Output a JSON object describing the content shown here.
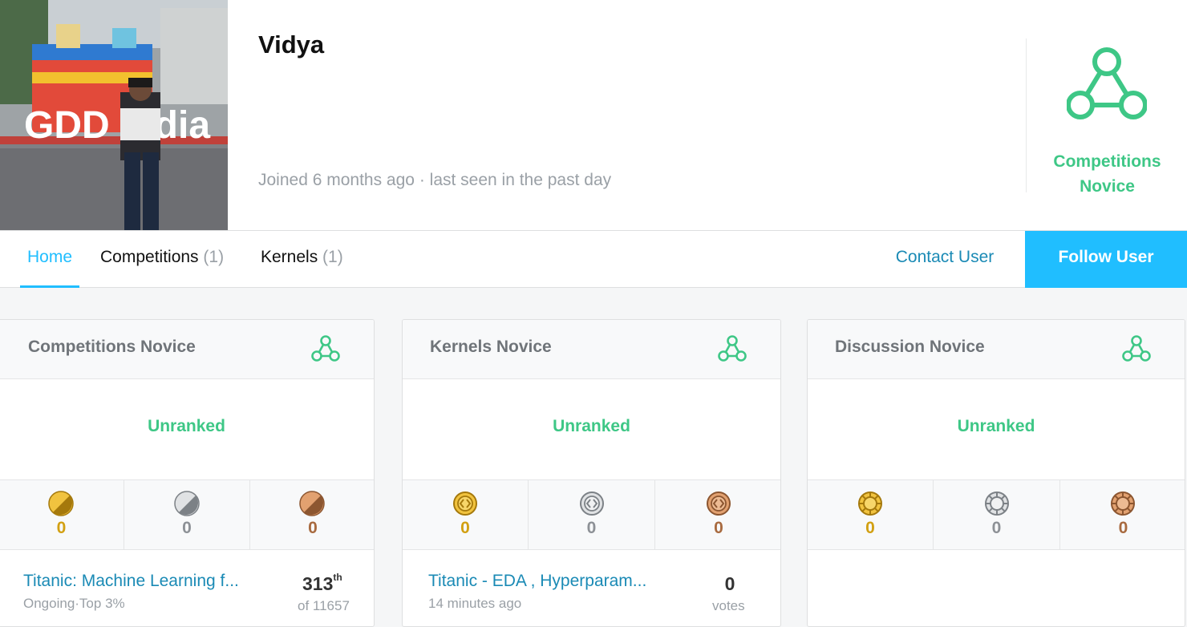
{
  "profile": {
    "name": "Vidya",
    "avatar_text": "GDD India",
    "joined": "Joined 6 months ago",
    "separator": "·",
    "last_seen": "last seen in the past day",
    "tier": {
      "line1": "Competitions",
      "line2": "Novice",
      "icon": "tier-novice-icon",
      "color": "#3ec786"
    }
  },
  "nav": {
    "tabs": [
      {
        "label": "Home",
        "count": ""
      },
      {
        "label": "Competitions",
        "count": "(1)"
      },
      {
        "label": "Kernels",
        "count": "(1)"
      }
    ],
    "contact": "Contact User",
    "follow": "Follow User"
  },
  "cards": [
    {
      "title": "Competitions Novice",
      "rank": "Unranked",
      "medals": {
        "gold": "0",
        "silver": "0",
        "bronze": "0"
      },
      "item": {
        "title": "Titanic: Machine Learning f...",
        "subtitle": "Ongoing·Top 3%",
        "rank_num": "313",
        "rank_suffix": "th",
        "rank_of": "of 11657"
      }
    },
    {
      "title": "Kernels Novice",
      "rank": "Unranked",
      "medals": {
        "gold": "0",
        "silver": "0",
        "bronze": "0"
      },
      "item": {
        "title": "Titanic - EDA , Hyperparam...",
        "subtitle": "14 minutes ago",
        "votes": "0",
        "votes_label": "votes"
      }
    },
    {
      "title": "Discussion Novice",
      "rank": "Unranked",
      "medals": {
        "gold": "0",
        "silver": "0",
        "bronze": "0"
      }
    }
  ],
  "colors": {
    "accent": "#20beff",
    "link": "#1a8ab5",
    "novice_green": "#3ec786",
    "gold": "#d2a012",
    "silver": "#8d9196",
    "bronze": "#a86a3f"
  }
}
